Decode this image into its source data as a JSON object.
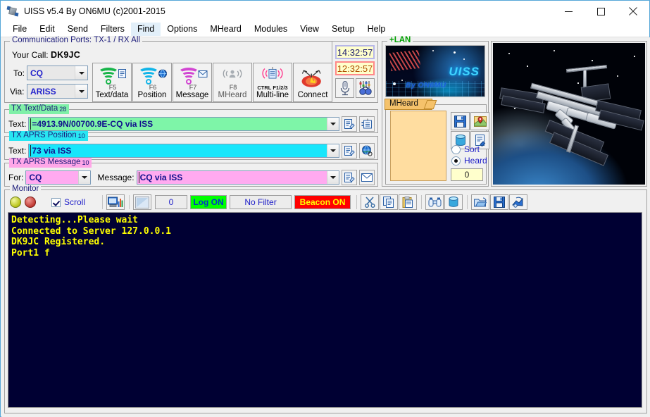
{
  "window": {
    "title": "UISS v5.4 By ON6MU (c)2001-2015",
    "icon": "satellite-icon",
    "minimize_label": "–",
    "maximize_label": "□",
    "close_label": "✕"
  },
  "menu": {
    "items": [
      {
        "label": "File",
        "active": false
      },
      {
        "label": "Edit",
        "active": false
      },
      {
        "label": "Send",
        "active": false
      },
      {
        "label": "Filters",
        "active": false
      },
      {
        "label": "Find",
        "active": true
      },
      {
        "label": "Options",
        "active": false
      },
      {
        "label": "MHeard",
        "active": false
      },
      {
        "label": "Modules",
        "active": false
      },
      {
        "label": "View",
        "active": false
      },
      {
        "label": "Setup",
        "active": false
      },
      {
        "label": "Help",
        "active": false
      }
    ]
  },
  "comm": {
    "group_title": "Communication Ports: TX-1 / RX All",
    "your_call_label": "Your Call:",
    "your_call_value": "DK9JC",
    "to_label": "To:",
    "to_value": "CQ",
    "via_label": "Via:",
    "via_value": "ARISS"
  },
  "toolbar_buttons": [
    {
      "name": "text-data",
      "label": "Text/data",
      "key": "F5",
      "color": "#18b54a",
      "badge": "document-icon"
    },
    {
      "name": "position",
      "label": "Position",
      "key": "F6",
      "color": "#12b5e8",
      "badge": "globe-icon"
    },
    {
      "name": "message",
      "label": "Message",
      "key": "F7",
      "color": "#d246d2",
      "badge": "envelope-icon"
    },
    {
      "name": "mheard",
      "label": "MHeard",
      "key": "F8",
      "color": "#9aa0a6",
      "badge": ""
    },
    {
      "name": "multi-line",
      "label": "Multi-line",
      "key": "CTRL F1/2/3",
      "color": "#ff3b8e",
      "badge": ""
    },
    {
      "name": "connect",
      "label": "Connect",
      "key": "",
      "color": "#e02020",
      "badge": ""
    }
  ],
  "clocks": {
    "utc": "14:32:57",
    "local": "12:32:57",
    "mic_button": "microphone-icon",
    "sound_button": "sound-settings-icon"
  },
  "tx_text": {
    "group_title": "TX Text/Data",
    "count": "28",
    "field_label": "Text:",
    "value": "=4913.9N/00700.9E-CQ via ISS",
    "edit_button": "edit-icon",
    "list_button": "list-icon"
  },
  "tx_position": {
    "group_title": "TX APRS Position",
    "count": "10",
    "field_label": "Text:",
    "value": "73 via ISS",
    "edit_button": "edit-icon",
    "globe_button": "globe-icon"
  },
  "tx_message": {
    "group_title": "TX APRS Message",
    "count": "10",
    "for_label": "For:",
    "for_value": "CQ",
    "message_label": "Message:",
    "value": "CQ via ISS",
    "edit_button": "edit-icon",
    "send_button": "envelope-icon"
  },
  "lan": {
    "title": "+LAN",
    "banner_logo": "UISS",
    "banner_sub": "By ON6MU"
  },
  "mheard": {
    "title": "MHeard",
    "entries": [],
    "buttons": [
      {
        "name": "save-icon"
      },
      {
        "name": "map-pin-icon"
      },
      {
        "name": "database-icon"
      },
      {
        "name": "report-icon"
      }
    ],
    "sort_label": "Sort",
    "heard_label": "Heard",
    "selected": "Heard",
    "count": "0"
  },
  "iss_panel": {
    "image_alt": "international-space-station-photo"
  },
  "monitor": {
    "group_title": "Monitor",
    "led_left": "led-yellow",
    "led_right": "led-red",
    "scroll_label": "Scroll",
    "scroll_checked": true,
    "chart_button": "chart-icon",
    "screen_button": "screen-icon",
    "count": "0",
    "log_status": "Log ON",
    "filter_status": "No Filter",
    "beacon_status": "Beacon ON",
    "edit_buttons": [
      {
        "name": "cut-icon"
      },
      {
        "name": "copy-icon"
      },
      {
        "name": "paste-icon"
      }
    ],
    "find_buttons": [
      {
        "name": "binoculars-icon"
      },
      {
        "name": "database-icon"
      }
    ],
    "file_buttons": [
      {
        "name": "open-folder-icon"
      },
      {
        "name": "save-icon"
      },
      {
        "name": "print-preview-icon"
      }
    ],
    "console_lines": [
      "Detecting...Please wait",
      "Connected to Server 127.0.0.1",
      "DK9JC Registered.",
      "Port1 f"
    ]
  },
  "colors": {
    "tx_text_bg": "#7ef5a8",
    "tx_position_bg": "#18e6fb",
    "tx_message_bg": "#ffaaf0",
    "console_bg": "#000033",
    "console_fg": "#ffff00",
    "log_on_bg": "#00ff00",
    "beacon_on_bg": "#ff0000"
  }
}
